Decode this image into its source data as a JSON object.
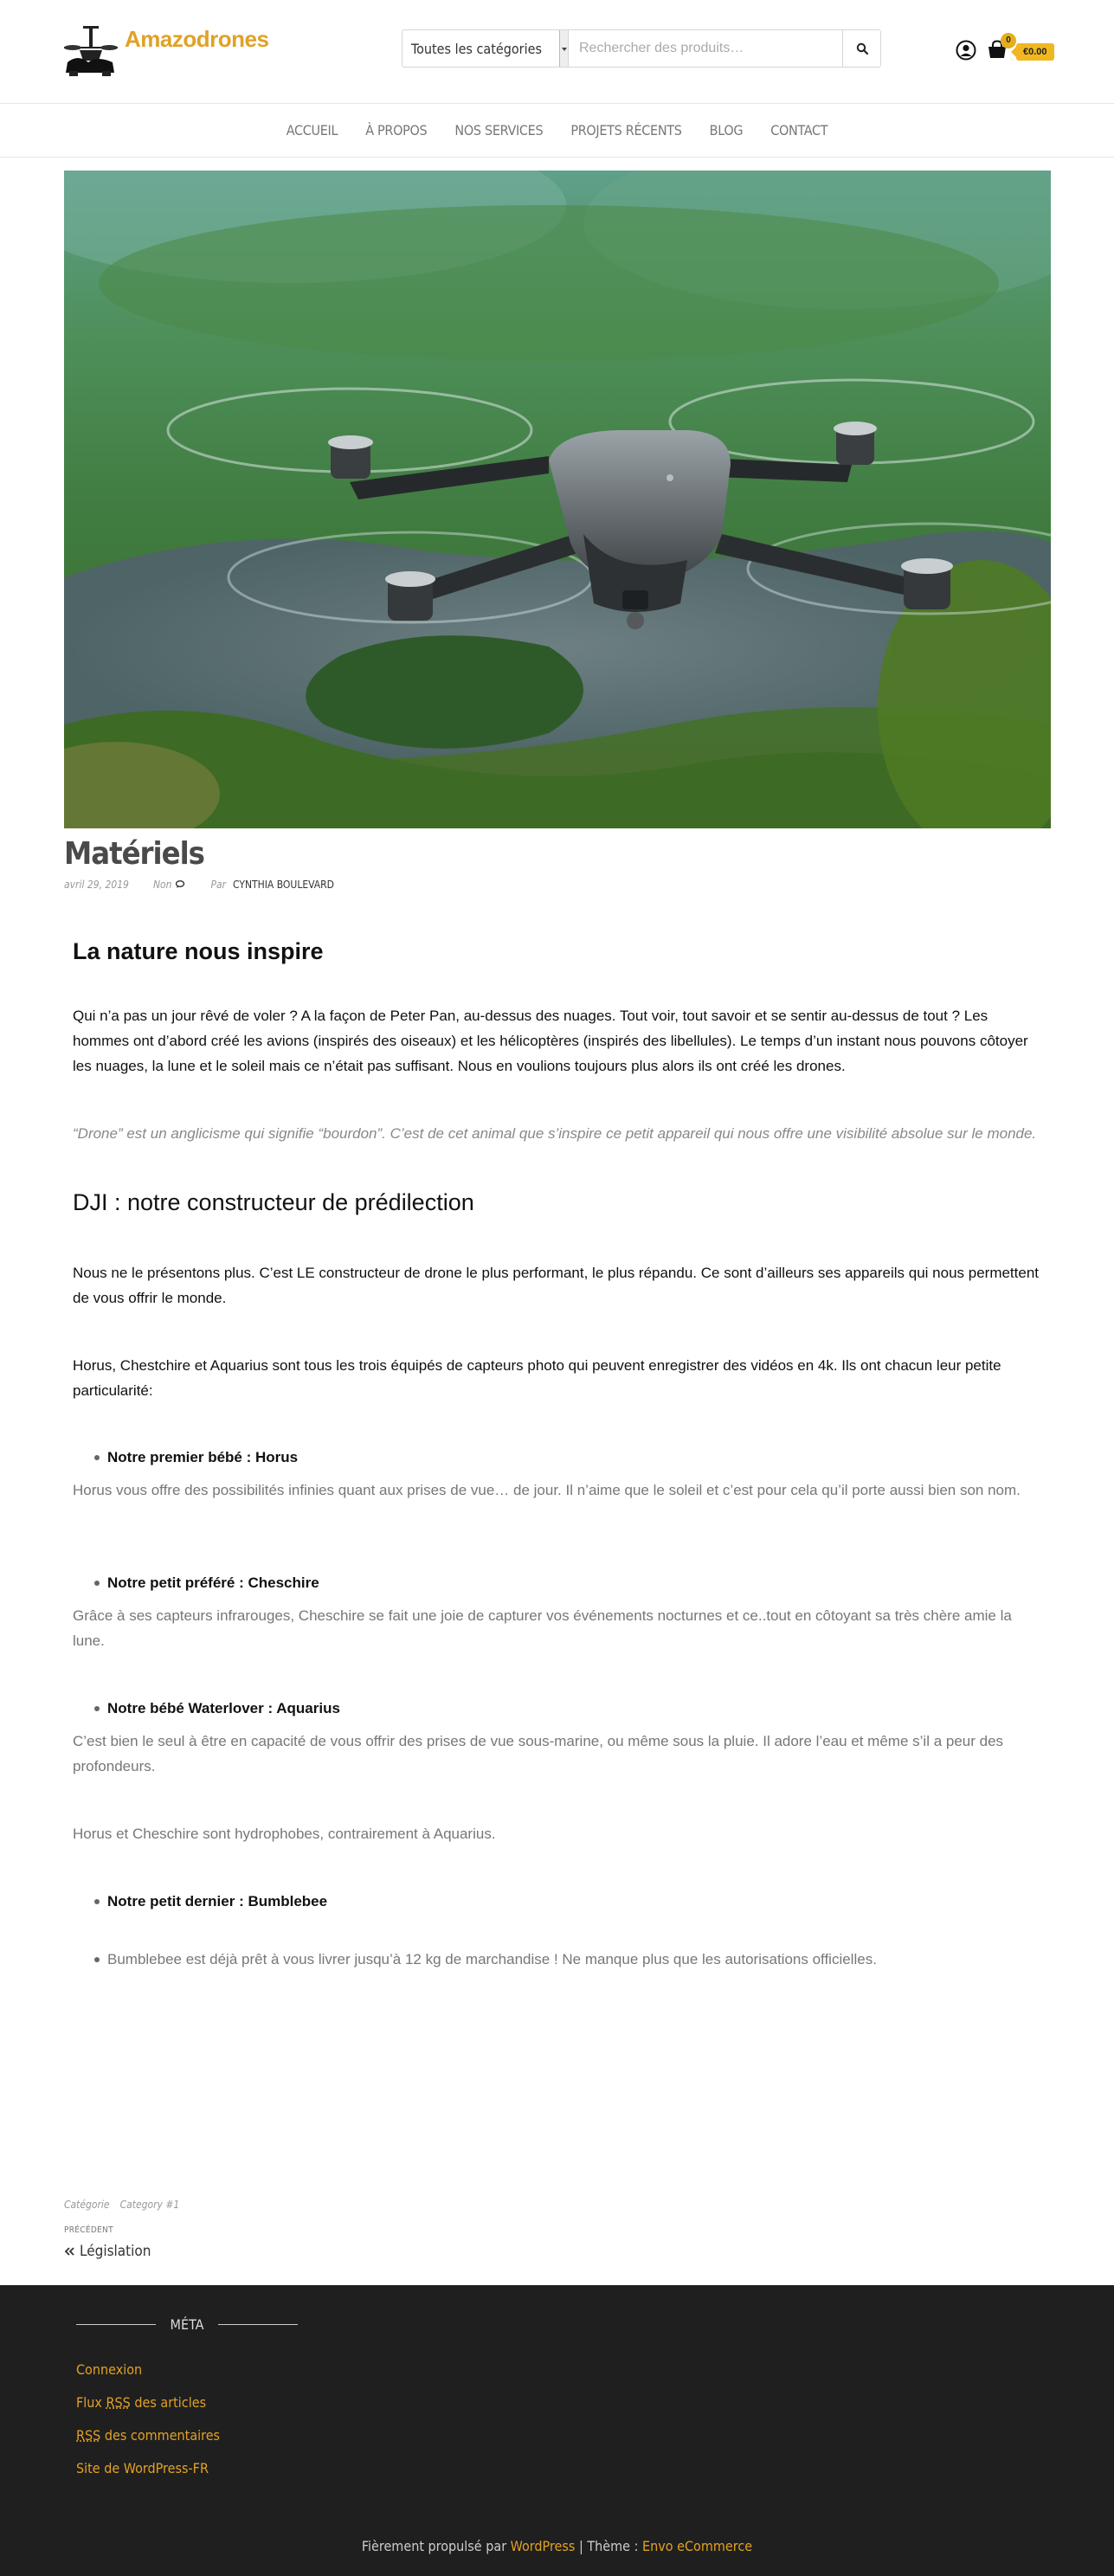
{
  "header": {
    "site_title": "Amazodrones",
    "search": {
      "category_selected": "Toutes les catégories",
      "placeholder": "Rechercher des produits…"
    },
    "cart": {
      "count": "0",
      "total": "€0.00"
    }
  },
  "nav": {
    "items": [
      "ACCUEIL",
      "À PROPOS",
      "NOS SERVICES",
      "PROJETS RÉCENTS",
      "BLOG",
      "CONTACT"
    ]
  },
  "post": {
    "title": "Matériels",
    "date": "avril 29, 2019",
    "comments": "Non",
    "by": "Par",
    "author": "CYNTHIA BOULEVARD"
  },
  "content": {
    "h_nature": "La nature nous inspire",
    "p_intro": "Qui n’a pas un jour rêvé de voler ? A la façon de Peter Pan, au-dessus des nuages. Tout voir, tout savoir et se sentir au-dessus de tout ? Les hommes ont d’abord créé les avions (inspirés des oiseaux) et les hélicoptères (inspirés des libellules). Le temps d’un instant nous pouvons côtoyer les nuages, la lune et le soleil mais ce n’était pas suffisant. Nous en voulions toujours plus alors ils ont créé les drones.",
    "quote": "“Drone” est un anglicisme qui signifie “bourdon”. C’est de cet animal que s’inspire ce petit appareil qui nous offre une visibilité absolue sur le monde.",
    "h_dji": "DJI : notre constructeur de prédilection",
    "p_dji": "Nous ne le présentons plus. C’est LE constructeur de drone le plus performant, le plus répandu. Ce sont d’ailleurs ses appareils qui nous permettent de vous offrir le monde.",
    "p_models": "Horus, Chestchire et Aquarius sont tous les trois équipés de capteurs photo qui peuvent enregistrer des vidéos en 4k. Ils ont chacun leur petite particularité:",
    "b_horus": "Notre premier bébé : Horus",
    "p_horus": "Horus vous offre des possibilités infinies quant aux prises de vue… de jour. Il n’aime que le soleil et c’est pour cela qu’il porte aussi bien son nom.",
    "b_cheschire": "Notre petit préféré : Cheschire",
    "p_cheschire": "Grâce à ses capteurs infrarouges, Cheschire se fait une joie de capturer vos événements nocturnes et ce..tout en côtoyant sa très chère amie la lune.",
    "b_aquarius": "Notre bébé Waterlover : Aquarius",
    "p_aquarius": "C’est bien le seul à être en capacité de vous offrir des prises de vue sous-marine, ou même sous la pluie. Il adore l’eau et même s’il a peur des profondeurs.",
    "p_hydro": "Horus et Cheschire sont hydrophobes, contrairement à Aquarius.",
    "b_bumblebee": "Notre petit dernier : Bumblebee",
    "b_bumblebee_text": "Bumblebee est déjà prêt à vous livrer jusqu’à 12 kg de marchandise ! Ne manque plus que les autorisations officielles."
  },
  "post_footer": {
    "category_label": "Catégorie",
    "category": "Category #1",
    "prev_label": "PRÉCÉDENT",
    "prev_link": "Législation"
  },
  "footer": {
    "meta_title": "MÉTA",
    "links": {
      "login": "Connexion",
      "rss_prefix_abbr": "RSS",
      "rss_articles_pre": "Flux ",
      "rss_articles_post": " des articles",
      "rss_comments_post": " des commentaires",
      "wordpress_fr": "Site de WordPress-FR"
    },
    "credits": {
      "prefix": "Fièrement propulsé par ",
      "wordpress": "WordPress",
      "sep": " | Thème : ",
      "theme": "Envo eCommerce"
    }
  },
  "colors": {
    "accent": "#e0a126",
    "cart_badge": "#f0b720",
    "footer_bg": "#1f1f1f"
  }
}
